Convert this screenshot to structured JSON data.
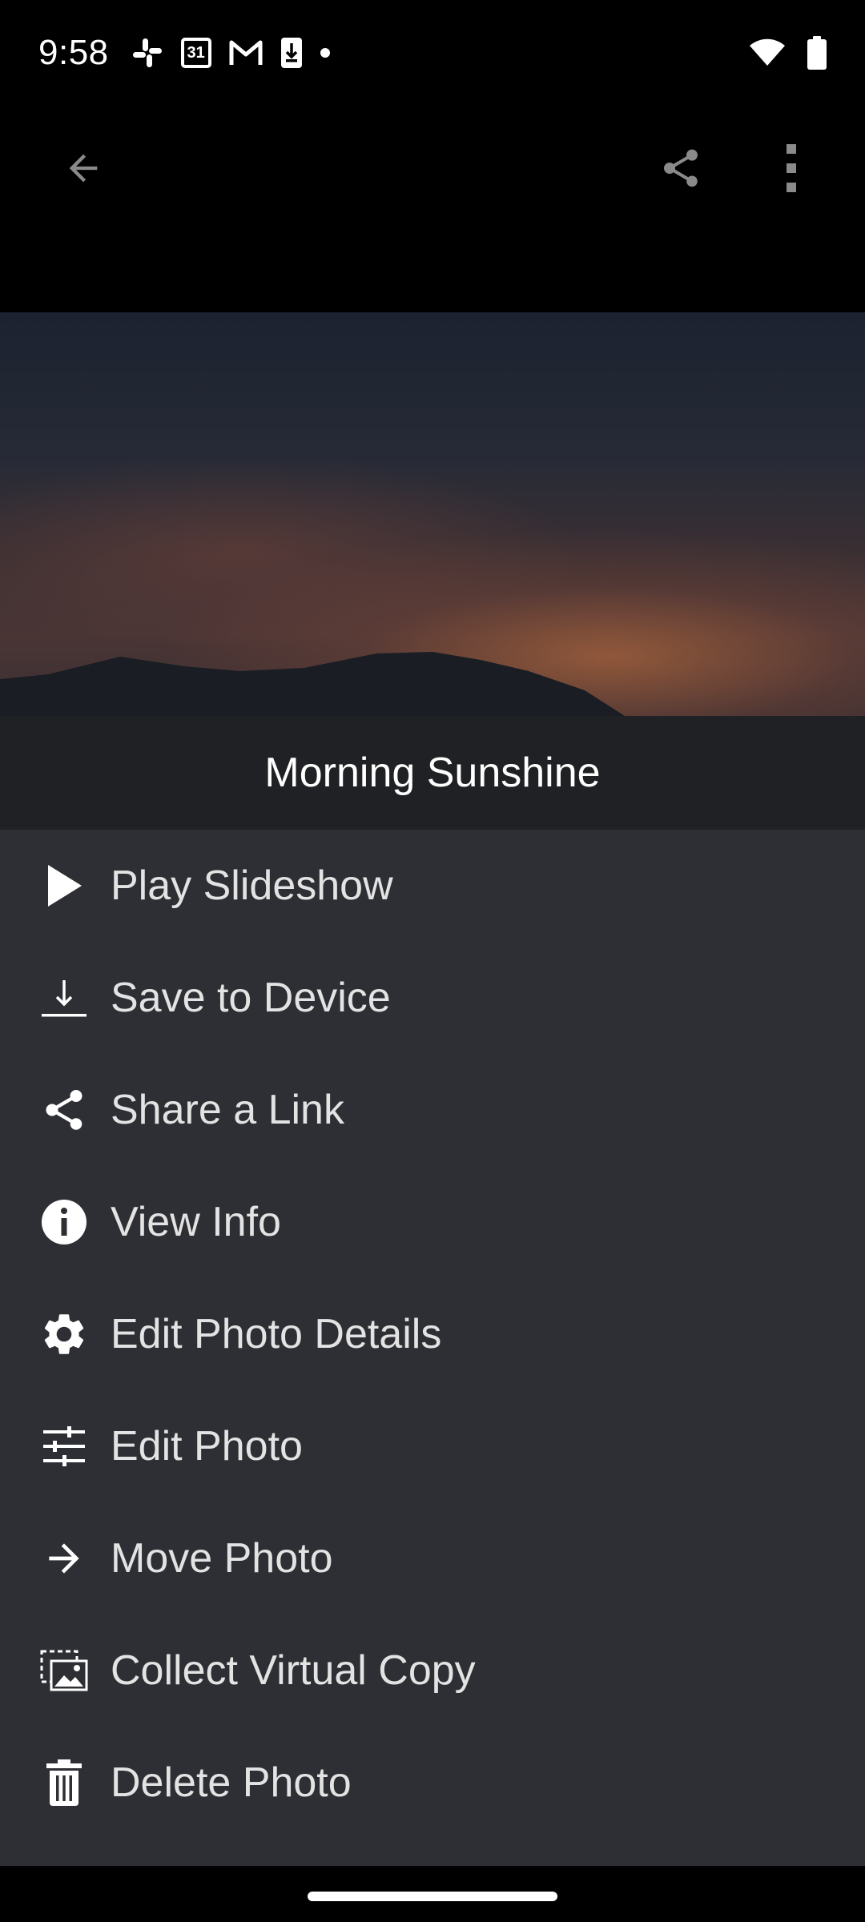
{
  "status_bar": {
    "time": "9:58",
    "calendar_day": "31",
    "left_icons": [
      "slack-icon",
      "calendar-icon",
      "gmail-icon",
      "download-icon",
      "dot-icon"
    ],
    "right_icons": [
      "wifi-icon",
      "battery-icon"
    ]
  },
  "app_bar": {
    "icons": [
      "back-arrow-icon",
      "share-icon",
      "more-vert-icon"
    ]
  },
  "photo": {
    "title": "Morning Sunshine"
  },
  "menu": {
    "items": [
      {
        "label": "Play Slideshow",
        "icon": "play-icon"
      },
      {
        "label": "Save to Device",
        "icon": "download-icon"
      },
      {
        "label": "Share a Link",
        "icon": "share-icon"
      },
      {
        "label": "View Info",
        "icon": "info-icon"
      },
      {
        "label": "Edit Photo Details",
        "icon": "gear-icon"
      },
      {
        "label": "Edit Photo",
        "icon": "sliders-icon"
      },
      {
        "label": "Move Photo",
        "icon": "arrow-right-icon"
      },
      {
        "label": "Collect Virtual Copy",
        "icon": "virtual-copy-icon"
      },
      {
        "label": "Delete Photo",
        "icon": "trash-icon"
      }
    ]
  },
  "colors": {
    "menu_background": "#2e2f34",
    "title_background": "#202124",
    "menu_text": "#e3e3e3",
    "app_bar_icon": "#8a8a8a"
  }
}
